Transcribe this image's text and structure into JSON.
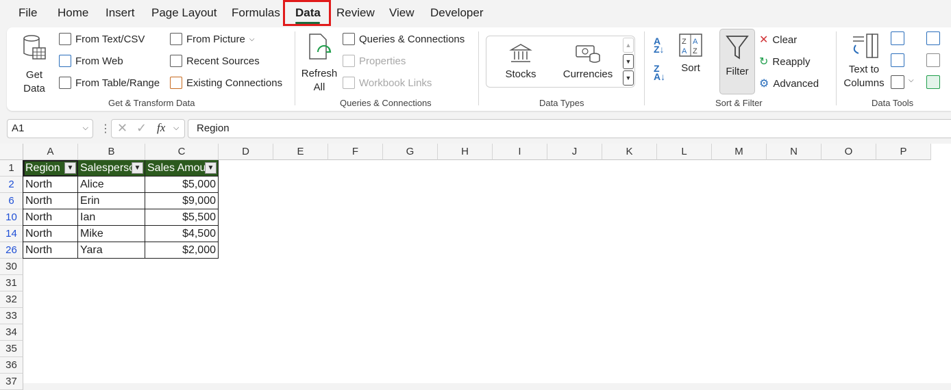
{
  "menu": {
    "tabs": [
      "File",
      "Home",
      "Insert",
      "Page Layout",
      "Formulas",
      "Data",
      "Review",
      "View",
      "Developer"
    ],
    "active_tab": "Data"
  },
  "ribbon": {
    "get_transform": {
      "get_data": "Get Data",
      "from_text_csv": "From Text/CSV",
      "from_web": "From Web",
      "from_table_range": "From Table/Range",
      "from_picture": "From Picture",
      "recent_sources": "Recent Sources",
      "existing_connections": "Existing Connections",
      "label": "Get & Transform Data"
    },
    "queries": {
      "refresh_all": "Refresh All",
      "queries_connections": "Queries & Connections",
      "properties": "Properties",
      "workbook_links": "Workbook Links",
      "label": "Queries & Connections"
    },
    "data_types": {
      "stocks": "Stocks",
      "currencies": "Currencies",
      "label": "Data Types"
    },
    "sort_filter": {
      "sort": "Sort",
      "filter": "Filter",
      "clear": "Clear",
      "reapply": "Reapply",
      "advanced": "Advanced",
      "label": "Sort & Filter"
    },
    "data_tools": {
      "text_to_columns": "Text to Columns",
      "label": "Data Tools"
    }
  },
  "formula_bar": {
    "name_box": "A1",
    "formula": "Region"
  },
  "sheet": {
    "columns": [
      "A",
      "B",
      "C",
      "D",
      "E",
      "F",
      "G",
      "H",
      "I",
      "J",
      "K",
      "L",
      "M",
      "N",
      "O",
      "P"
    ],
    "header_row": [
      "Region",
      "Salesperson",
      "Sales Amount"
    ],
    "rows": [
      {
        "row_number": "2",
        "values": [
          "North",
          "Alice",
          "$5,000"
        ]
      },
      {
        "row_number": "6",
        "values": [
          "North",
          "Erin",
          "$9,000"
        ]
      },
      {
        "row_number": "10",
        "values": [
          "North",
          "Ian",
          "$5,500"
        ]
      },
      {
        "row_number": "14",
        "values": [
          "North",
          "Mike",
          "$4,500"
        ]
      },
      {
        "row_number": "26",
        "values": [
          "North",
          "Yara",
          "$2,000"
        ]
      }
    ],
    "empty_rows": [
      "30",
      "31",
      "32",
      "33",
      "34",
      "35",
      "36",
      "37"
    ],
    "header_color": "#2c5a1e",
    "filtered_row_color": "#1e4fd6"
  }
}
